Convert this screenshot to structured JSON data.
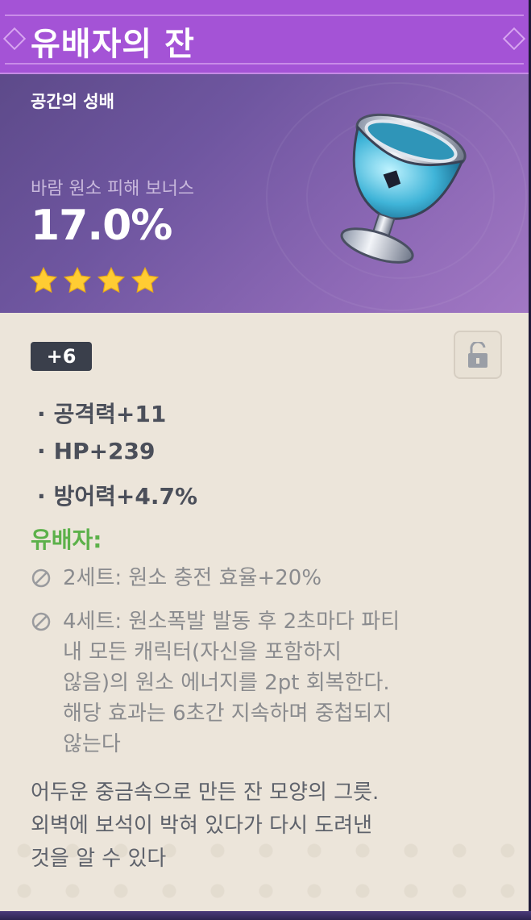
{
  "artifact": {
    "name": "유배자의 잔",
    "slot": "공간의 성배",
    "main_stat": {
      "label": "바람 원소 피해 보너스",
      "value": "17.0%"
    },
    "rarity": 4,
    "level": "+6",
    "substats": [
      {
        "text": "공격력+11"
      },
      {
        "text": "HP+239"
      },
      {
        "text": "방어력+4.7%"
      }
    ],
    "set": {
      "name": "유배자:",
      "bonuses": [
        {
          "text": "2세트: 원소 충전 효율+20%"
        },
        {
          "text": "4세트: 원소폭발 발동 후 2초마다 파티\n내 모든 캐릭터(자신을 포함하지\n않음)의 원소 에너지를 2pt 회복한다.\n해당 효과는 6초간 지속하며 중첩되지\n않는다"
        }
      ]
    },
    "description": "어두운 중금속으로 만든 잔 모양의 그릇.\n외벽에 보석이 박혀 있다가 다시 도려낸\n것을 알 수 있다"
  },
  "icons": {
    "lock": "unlocked-padlock-icon",
    "star": "star-icon",
    "set_inactive": "disabled-circle-icon",
    "item": "goblet-icon"
  },
  "colors": {
    "title_bar": "#a453d6",
    "set_name": "#5cb14a",
    "star": "#ffcc33",
    "inactive_text": "#8a8b8e"
  }
}
